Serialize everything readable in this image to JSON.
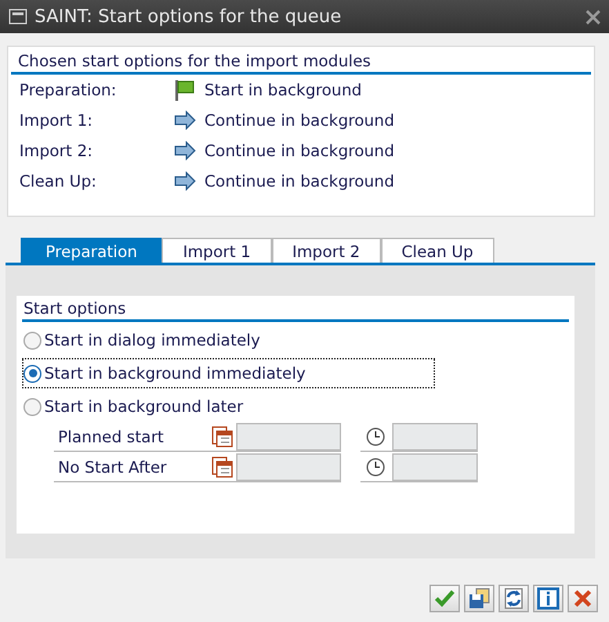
{
  "window": {
    "title": "SAINT: Start options for the queue"
  },
  "summary": {
    "title": "Chosen start options for the import modules",
    "rows": [
      {
        "label": "Preparation:",
        "kind": "flag",
        "value": "Start in background"
      },
      {
        "label": "Import 1:",
        "kind": "arrow",
        "value": "Continue in background"
      },
      {
        "label": "Import 2:",
        "kind": "arrow",
        "value": "Continue in background"
      },
      {
        "label": "Clean Up:",
        "kind": "arrow",
        "value": "Continue in background"
      }
    ]
  },
  "tabs": [
    {
      "label": "Preparation",
      "selected": true
    },
    {
      "label": "Import 1",
      "selected": false
    },
    {
      "label": "Import 2",
      "selected": false
    },
    {
      "label": "Clean Up",
      "selected": false
    }
  ],
  "start_options": {
    "title": "Start options",
    "radios": [
      {
        "label": "Start in dialog immediately",
        "selected": false,
        "focused": false
      },
      {
        "label": "Start in background immediately",
        "selected": true,
        "focused": true
      },
      {
        "label": "Start in background later",
        "selected": false,
        "focused": false
      }
    ],
    "schedule": [
      {
        "label": "Planned start",
        "disabled": true
      },
      {
        "label": "No Start After",
        "disabled": true
      }
    ]
  },
  "buttons": [
    {
      "kind": "confirm"
    },
    {
      "kind": "save"
    },
    {
      "kind": "refresh"
    },
    {
      "kind": "info"
    },
    {
      "kind": "cancel"
    }
  ]
}
